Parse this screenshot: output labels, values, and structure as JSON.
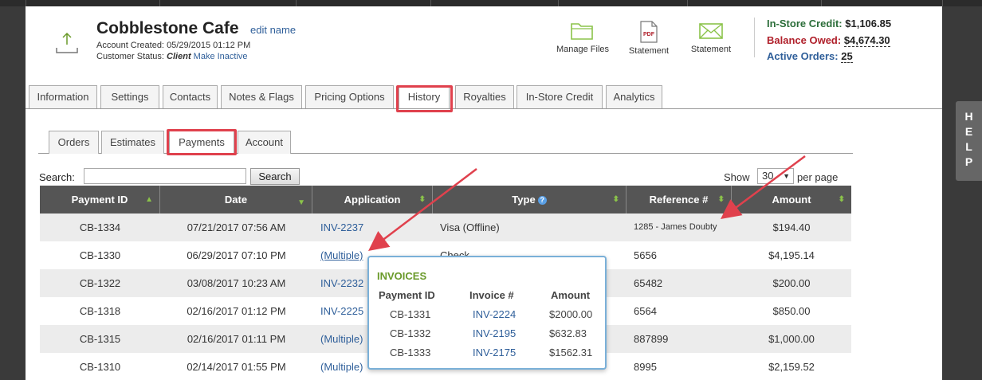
{
  "customer": {
    "name": "Cobblestone Cafe",
    "edit_name_label": "edit name",
    "account_created_label": "Account Created:",
    "account_created_value": "05/29/2015 01:12 PM",
    "status_label": "Customer Status:",
    "status_value": "Client",
    "make_inactive_label": "Make Inactive"
  },
  "header_actions": [
    {
      "label": "Manage Files",
      "icon": "folder-icon"
    },
    {
      "label": "Statement",
      "icon": "pdf-icon"
    },
    {
      "label": "Statement",
      "icon": "envelope-icon"
    }
  ],
  "balances": {
    "in_store_credit_label": "In-Store Credit:",
    "in_store_credit_value": "$1,106.85",
    "balance_owed_label": "Balance Owed:",
    "balance_owed_value": "$4,674.30",
    "active_orders_label": "Active Orders:",
    "active_orders_value": "25"
  },
  "main_tabs": [
    "Information",
    "Settings",
    "Contacts",
    "Notes & Flags",
    "Pricing Options",
    "History",
    "Royalties",
    "In-Store Credit",
    "Analytics"
  ],
  "active_main_tab": "History",
  "sub_tabs": [
    "Orders",
    "Estimates",
    "Payments",
    "Account"
  ],
  "active_sub_tab": "Payments",
  "search": {
    "label": "Search:",
    "value": "",
    "placeholder": "",
    "button_label": "Search"
  },
  "paging": {
    "show_label": "Show",
    "per_page_value": "30",
    "per_page_label": "per page"
  },
  "table": {
    "columns": [
      "Payment ID",
      "Date",
      "Application",
      "Type",
      "Reference #",
      "Amount"
    ],
    "rows": [
      {
        "id": "CB-1334",
        "date": "07/21/2017 07:56 AM",
        "application": "INV-2237",
        "type": "Visa (Offline)",
        "reference": "1285 - James Doubty",
        "amount": "$194.40"
      },
      {
        "id": "CB-1330",
        "date": "06/29/2017 07:10 PM",
        "application": "(Multiple)",
        "type": "Check",
        "reference": "5656",
        "amount": "$4,195.14"
      },
      {
        "id": "CB-1322",
        "date": "03/08/2017 10:23 AM",
        "application": "INV-2232",
        "type": "",
        "reference": "65482",
        "amount": "$200.00"
      },
      {
        "id": "CB-1318",
        "date": "02/16/2017 01:12 PM",
        "application": "INV-2225",
        "type": "",
        "reference": "6564",
        "amount": "$850.00"
      },
      {
        "id": "CB-1315",
        "date": "02/16/2017 01:11 PM",
        "application": "(Multiple)",
        "type": "",
        "reference": "887899",
        "amount": "$1,000.00"
      },
      {
        "id": "CB-1310",
        "date": "02/14/2017 01:55 PM",
        "application": "(Multiple)",
        "type": "",
        "reference": "8995",
        "amount": "$2,159.52"
      }
    ]
  },
  "invoices_popup": {
    "title": "INVOICES",
    "columns": [
      "Payment ID",
      "Invoice #",
      "Amount"
    ],
    "rows": [
      {
        "payment_id": "CB-1331",
        "invoice": "INV-2224",
        "amount": "$2000.00"
      },
      {
        "payment_id": "CB-1332",
        "invoice": "INV-2195",
        "amount": "$632.83"
      },
      {
        "payment_id": "CB-1333",
        "invoice": "INV-2175",
        "amount": "$1562.31"
      }
    ]
  },
  "help_label": [
    "H",
    "E",
    "L",
    "P"
  ],
  "colors": {
    "link": "#2f5f9a",
    "highlight": "#e0414d",
    "header_bg": "#555555",
    "credit": "#2c6e3a",
    "owed": "#b0202b",
    "icon_green": "#8bc34a"
  }
}
